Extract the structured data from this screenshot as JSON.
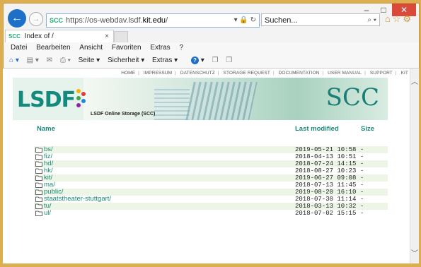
{
  "browser": {
    "address": {
      "url_prefix": "https://os-webdav.lsdf.",
      "url_domain": "kit.edu",
      "url_suffix": "/",
      "favicon": "SCC"
    },
    "search_placeholder": "Suchen...",
    "tab": {
      "title": "Index of /",
      "favicon": "SCC",
      "close": "×"
    },
    "menu": [
      "Datei",
      "Bearbeiten",
      "Ansicht",
      "Favoriten",
      "Extras",
      "?"
    ],
    "toolbar": {
      "seite": "Seite ▾",
      "sicherheit": "Sicherheit ▾",
      "extras": "Extras ▾"
    },
    "window_buttons": {
      "minimize": "–",
      "maximize": "□",
      "close": "✕"
    }
  },
  "page": {
    "top_links": [
      "HOME",
      "IMPRESSUM",
      "DATENSCHUTZ",
      "STORAGE REQUEST",
      "DOCUMENTATION",
      "USER MANUAL",
      "SUPPORT",
      "KIT"
    ],
    "logo_text": "LSDF",
    "banner_subtitle": "LSDF Online Storage (SCC)",
    "scc_logo": "SCC",
    "columns": {
      "name": "Name",
      "modified": "Last modified",
      "size": "Size"
    },
    "entries": [
      {
        "name": "bs/",
        "modified": "2019-05-21 10:58",
        "size": "-"
      },
      {
        "name": "fiz/",
        "modified": "2018-04-13 10:51",
        "size": "-"
      },
      {
        "name": "hd/",
        "modified": "2018-07-24 14:15",
        "size": "-"
      },
      {
        "name": "hk/",
        "modified": "2018-08-27 10:23",
        "size": "-"
      },
      {
        "name": "kit/",
        "modified": "2019-06-27 09:08",
        "size": "-"
      },
      {
        "name": "ma/",
        "modified": "2018-07-13 11:45",
        "size": "-"
      },
      {
        "name": "public/",
        "modified": "2019-08-20 16:10",
        "size": "-"
      },
      {
        "name": "staatstheater-stuttgart/",
        "modified": "2018-07-30 11:14",
        "size": "-"
      },
      {
        "name": "tu/",
        "modified": "2018-03-13 10:32",
        "size": "-"
      },
      {
        "name": "ul/",
        "modified": "2018-07-02 15:15",
        "size": "-"
      }
    ]
  },
  "colors": {
    "accent": "#1a8a7a",
    "row_stripe": "#edf6e6",
    "frame": "#dcae4f"
  }
}
